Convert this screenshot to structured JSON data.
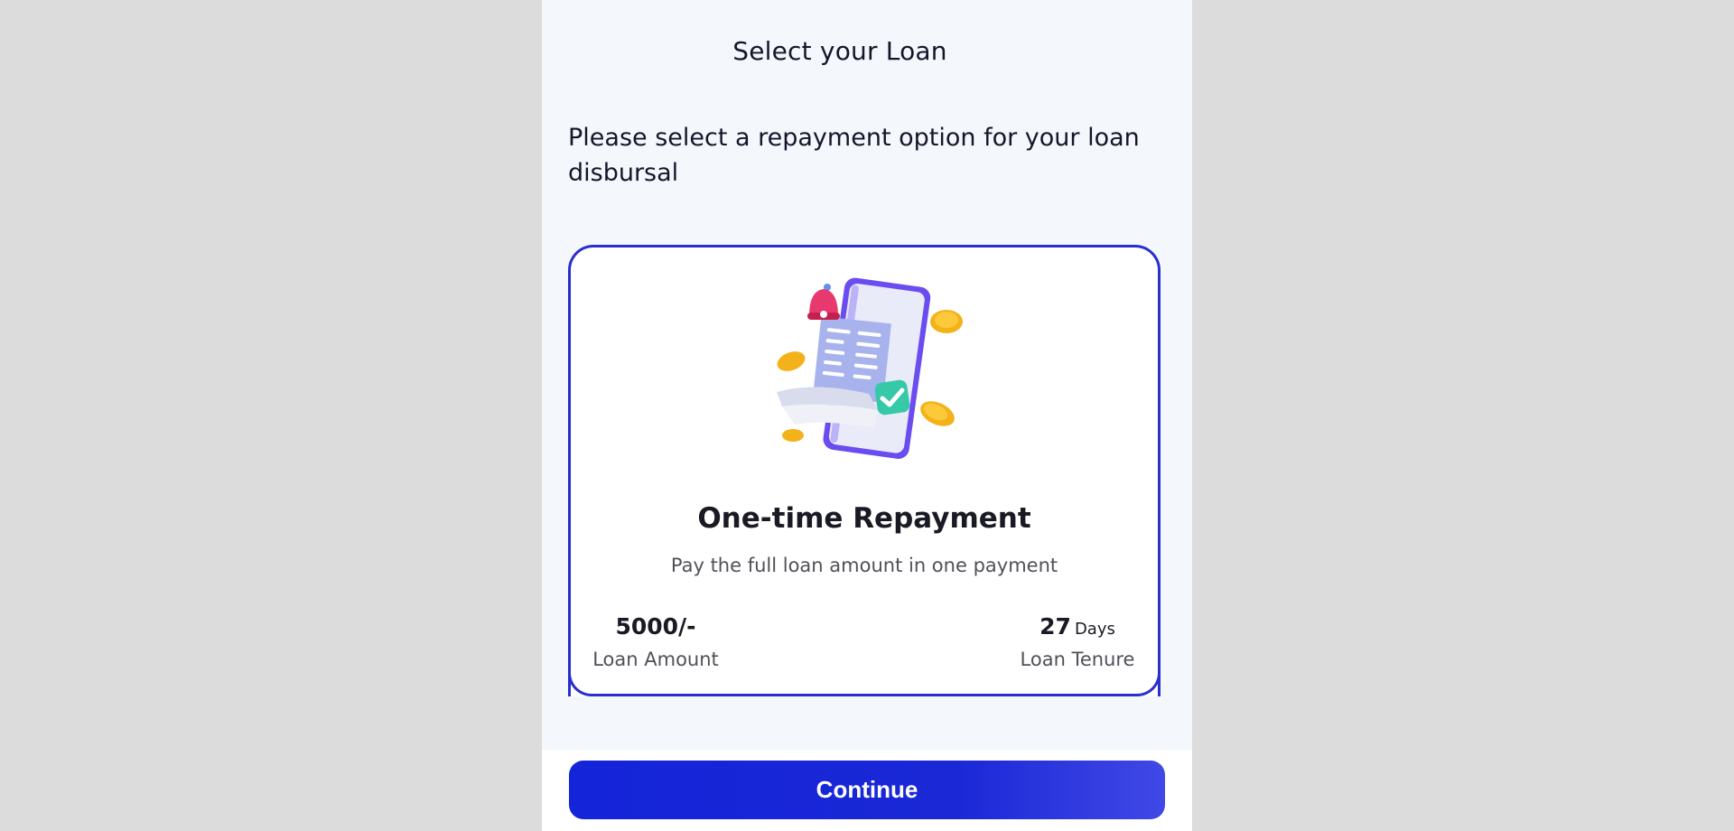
{
  "header": {
    "title": "Select your Loan"
  },
  "prompt": {
    "text": "Please select a repayment option for your loan disbursal"
  },
  "repayment_option": {
    "illustration_icon": "phone-bill-coins-illustration",
    "title": "One-time Repayment",
    "description": "Pay the full loan amount in one payment",
    "loan_amount": {
      "value": "5000/-",
      "label": "Loan Amount"
    },
    "loan_tenure": {
      "value": "27",
      "unit": "Days",
      "label": "Loan Tenure"
    },
    "selected": true,
    "border_color": "#2a2ecf"
  },
  "footer": {
    "continue_label": "Continue",
    "button_color": "#1424d8"
  },
  "colors": {
    "page_background": "#dcdcdc",
    "screen_background": "#f4f7fc",
    "card_background": "#ffffff"
  }
}
